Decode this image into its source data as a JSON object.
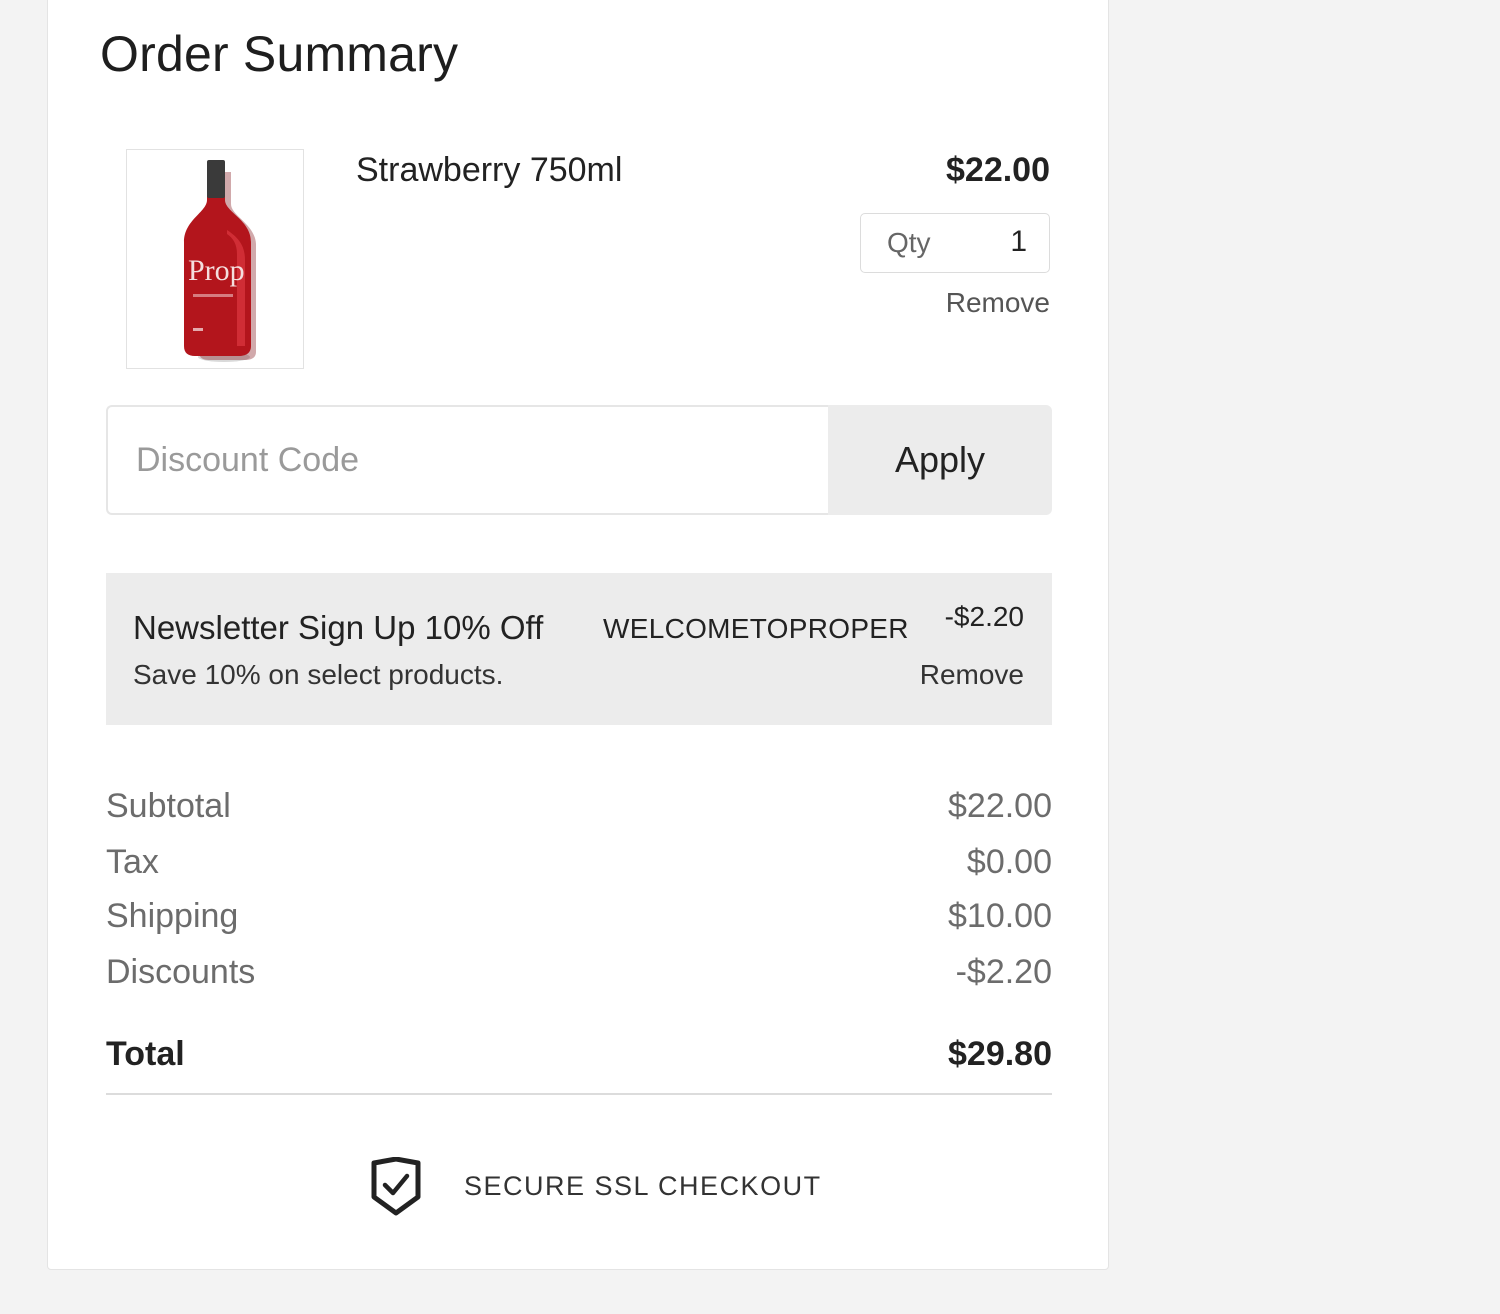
{
  "order_summary": {
    "title": "Order Summary",
    "item": {
      "name": "Strawberry 750ml",
      "price": "$22.00",
      "qty_label": "Qty",
      "qty_value": "1",
      "remove_label": "Remove",
      "image": "wine-bottle-icon",
      "bottle_color": "#b3151c",
      "bottle_label_text": "Prop"
    },
    "discount": {
      "placeholder": "Discount Code",
      "value": "",
      "apply_label": "Apply"
    },
    "promo": {
      "name": "Newsletter Sign Up 10% Off",
      "code": "WELCOMETOPROPER",
      "amount": "-$2.20",
      "description": "Save 10% on select products.",
      "remove_label": "Remove"
    },
    "summary": {
      "subtotal_label": "Subtotal",
      "subtotal_value": "$22.00",
      "tax_label": "Tax",
      "tax_value": "$0.00",
      "shipping_label": "Shipping",
      "shipping_value": "$10.00",
      "discounts_label": "Discounts",
      "discounts_value": "-$2.20",
      "total_label": "Total",
      "total_value": "$29.80"
    },
    "secure": {
      "label": "SECURE SSL CHECKOUT",
      "icon": "shield-check-icon"
    }
  },
  "colors": {
    "page_background": "#f3f3f3",
    "card_background": "#ffffff",
    "panel_gray": "#ececec",
    "text_dark": "#222222",
    "text_muted": "#6c6c6c"
  }
}
